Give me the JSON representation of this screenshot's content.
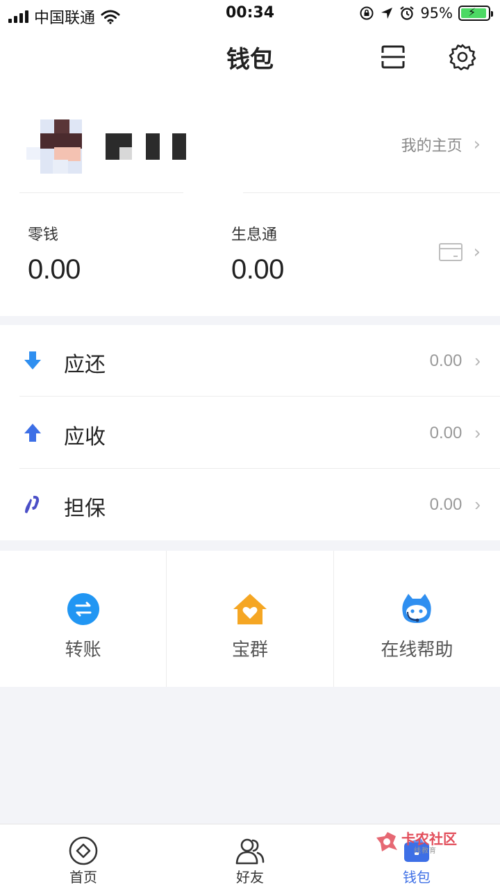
{
  "status_bar": {
    "carrier": "中国联通",
    "time": "00:34",
    "battery_percent": "95%",
    "battery_level": 0.95,
    "icons": [
      "signal-icon",
      "wifi-icon",
      "rotation-lock-icon",
      "location-icon",
      "alarm-icon",
      "battery-icon"
    ]
  },
  "nav": {
    "title": "钱包",
    "scan_icon": "scan-icon",
    "settings_icon": "gear-icon"
  },
  "profile": {
    "homepage_label": "我的主页"
  },
  "balances": {
    "change_label": "零钱",
    "change_value": "0.00",
    "interest_label": "生息通",
    "interest_value": "0.00",
    "card_icon": "bank-card-icon"
  },
  "list": [
    {
      "label": "应还",
      "value": "0.00",
      "icon": "arrow-down-icon",
      "color": "#2f8ff0"
    },
    {
      "label": "应收",
      "value": "0.00",
      "icon": "arrow-up-icon",
      "color": "#3d6fe6"
    },
    {
      "label": "担保",
      "value": "0.00",
      "icon": "guarantee-icon",
      "color": "#4b4fc7"
    }
  ],
  "grid": [
    {
      "label": "转账",
      "icon": "transfer-icon",
      "color": "#2196f3"
    },
    {
      "label": "宝群",
      "icon": "house-heart-icon",
      "color": "#f5a623"
    },
    {
      "label": "在线帮助",
      "icon": "support-robot-icon",
      "color": "#2f8ff0"
    }
  ],
  "tabs": [
    {
      "label": "首页",
      "icon": "home-diamond-icon",
      "active": false
    },
    {
      "label": "好友",
      "icon": "friends-icon",
      "active": false
    },
    {
      "label": "钱包",
      "icon": "wallet-icon",
      "active": true
    }
  ],
  "watermark": {
    "text": "卡农社区",
    "sub": "线教育"
  },
  "colors": {
    "accent": "#3d6fe6",
    "background": "#f3f4f8",
    "battery": "#4cd964"
  }
}
